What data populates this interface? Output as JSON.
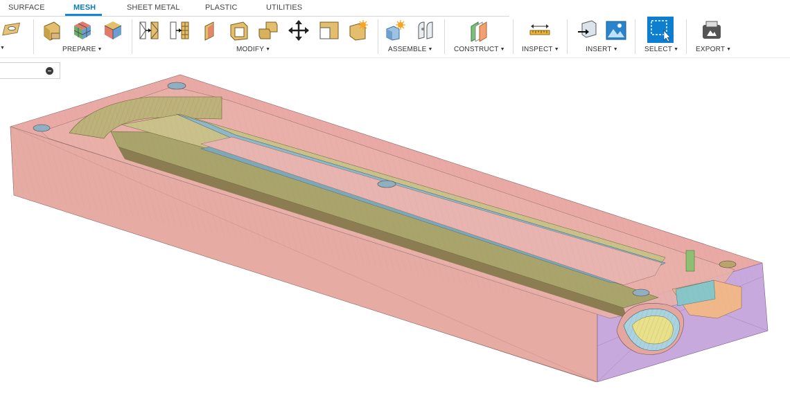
{
  "tabs": [
    {
      "label": "SURFACE",
      "active": false
    },
    {
      "label": "MESH",
      "active": true
    },
    {
      "label": "SHEET METAL",
      "active": false
    },
    {
      "label": "PLASTIC",
      "active": false
    },
    {
      "label": "UTILITIES",
      "active": false
    }
  ],
  "toolbar": {
    "groups": [
      {
        "label": "PREPARE",
        "icons": [
          "cube-mesh-icon",
          "colored-faces-icon",
          "face-groups-icon"
        ]
      },
      {
        "label": "MODIFY",
        "icons": [
          "split-triangles-icon",
          "remesh-icon",
          "fold-face-icon",
          "shell-icon",
          "combine-icon",
          "move-icon",
          "plane-cut-icon",
          "reverse-normal-icon"
        ]
      },
      {
        "label": "ASSEMBLE",
        "icons": [
          "new-component-icon",
          "joint-icon"
        ]
      },
      {
        "label": "CONSTRUCT",
        "icons": [
          "offset-plane-icon"
        ]
      },
      {
        "label": "INSPECT",
        "icons": [
          "measure-icon"
        ]
      },
      {
        "label": "INSERT",
        "icons": [
          "insert-mesh-icon",
          "insert-image-icon"
        ]
      },
      {
        "label": "SELECT",
        "icons": [
          "select-window-icon"
        ]
      },
      {
        "label": "EXPORT",
        "icons": [
          "export-icon"
        ]
      }
    ]
  },
  "colors": {
    "accent": "#0f8ad0",
    "mesh_pink": "#e9aaa6",
    "mesh_blue": "#8fb7c6",
    "mesh_olive": "#b9b47a",
    "mesh_purple": "#c8a9dd"
  }
}
